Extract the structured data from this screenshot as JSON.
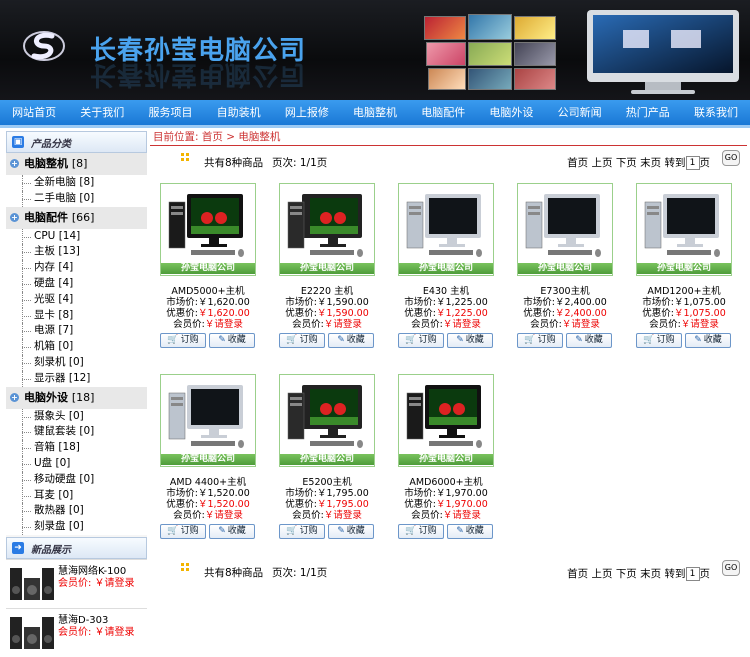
{
  "header": {
    "company_name": "长春孙莹电脑公司"
  },
  "nav": [
    "网站首页",
    "关于我们",
    "服务项目",
    "自助装机",
    "网上报修",
    "电脑整机",
    "电脑配件",
    "电脑外设",
    "公司新闻",
    "热门产品",
    "联系我们"
  ],
  "sidebar": {
    "category_title": "产品分类",
    "categories": [
      {
        "name": "电脑整机",
        "count": "[8]",
        "items": [
          {
            "name": "全新电脑",
            "count": "[8]"
          },
          {
            "name": "二手电脑",
            "count": "[0]"
          }
        ]
      },
      {
        "name": "电脑配件",
        "count": "[66]",
        "items": [
          {
            "name": "CPU",
            "count": "[14]"
          },
          {
            "name": "主板",
            "count": "[13]"
          },
          {
            "name": "内存",
            "count": "[4]"
          },
          {
            "name": "硬盘",
            "count": "[4]"
          },
          {
            "name": "光驱",
            "count": "[4]"
          },
          {
            "name": "显卡",
            "count": "[8]"
          },
          {
            "name": "电源",
            "count": "[7]"
          },
          {
            "name": "机箱",
            "count": "[0]"
          },
          {
            "name": "刻录机",
            "count": "[0]"
          },
          {
            "name": "显示器",
            "count": "[12]"
          }
        ]
      },
      {
        "name": "电脑外设",
        "count": "[18]",
        "items": [
          {
            "name": "摄象头",
            "count": "[0]"
          },
          {
            "name": "键鼠套装",
            "count": "[0]"
          },
          {
            "name": "音箱",
            "count": "[18]"
          },
          {
            "name": "U盘",
            "count": "[0]"
          },
          {
            "name": "移动硬盘",
            "count": "[0]"
          },
          {
            "name": "耳麦",
            "count": "[0]"
          },
          {
            "name": "散热器",
            "count": "[0]"
          },
          {
            "name": "刻录盘",
            "count": "[0]"
          }
        ]
      }
    ],
    "new_title": "新品展示",
    "new_products": [
      {
        "name": "慧海网络K-100",
        "price": "会员价: ￥请登录"
      },
      {
        "name": "慧海D-303",
        "price": "会员价: ￥请登录"
      }
    ]
  },
  "breadcrumb": "目前位置: 首页 > 电脑整机",
  "pager": {
    "total": "共有8种商品",
    "pages": "页次: 1/1页",
    "first": "首页",
    "prev": "上页",
    "next": "下页",
    "last": "末页",
    "goto": "转到",
    "page_value": "1",
    "page_suffix": "页",
    "go": "GO"
  },
  "product_band": "孙莹电脑公司",
  "labels": {
    "market": "市场价:",
    "discount": "优惠价:",
    "member": "会员价:",
    "login": "￥请登录",
    "order": "订购",
    "fav": "收藏"
  },
  "products": [
    {
      "name": "AMD5000+主机",
      "market": "￥1,620.00",
      "discount": "￥1,620.00",
      "style": "black"
    },
    {
      "name": "E2220 主机",
      "market": "￥1,590.00",
      "discount": "￥1,590.00",
      "style": "widescreen"
    },
    {
      "name": "E430 主机",
      "market": "￥1,225.00",
      "discount": "￥1,225.00",
      "style": "silver"
    },
    {
      "name": "E7300主机",
      "market": "￥2,400.00",
      "discount": "￥2,400.00",
      "style": "silver"
    },
    {
      "name": "AMD1200+主机",
      "market": "￥1,075.00",
      "discount": "￥1,075.00",
      "style": "silver"
    },
    {
      "name": "AMD 4400+主机",
      "market": "￥1,520.00",
      "discount": "￥1,520.00",
      "style": "silver"
    },
    {
      "name": "E5200主机",
      "market": "￥1,795.00",
      "discount": "￥1,795.00",
      "style": "widescreen"
    },
    {
      "name": "AMD6000+主机",
      "market": "￥1,970.00",
      "discount": "￥1,970.00",
      "style": "black"
    }
  ]
}
